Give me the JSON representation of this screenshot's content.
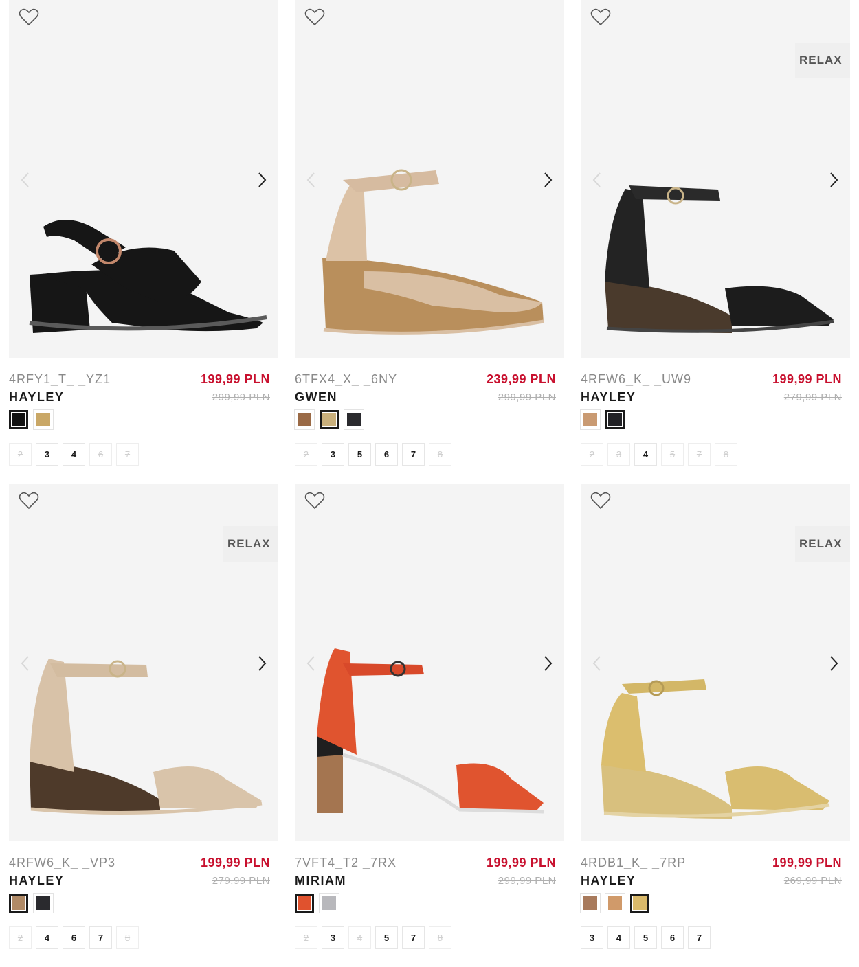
{
  "colors": {
    "price_red": "#c8102e",
    "old_price_grey": "#b0b0b0",
    "image_bg": "#f4f4f4"
  },
  "icons": {
    "wishlist": "heart-outline-icon",
    "prev": "chevron-left-icon",
    "next": "chevron-right-icon"
  },
  "products": [
    {
      "code": "4RFY1_T_ _YZ1",
      "name": "HAYLEY",
      "price": "199,99 PLN",
      "old_price": "299,99 PLN",
      "badge": "",
      "colors": [
        {
          "hex": "#111111",
          "selected": true
        },
        {
          "hex": "#c9a766",
          "selected": false
        }
      ],
      "sizes": [
        {
          "label": "2",
          "available": false
        },
        {
          "label": "3",
          "available": true
        },
        {
          "label": "4",
          "available": true
        },
        {
          "label": "6",
          "available": false
        },
        {
          "label": "7",
          "available": false
        }
      ]
    },
    {
      "code": "6TFX4_X_ _6NY",
      "name": "GWEN",
      "price": "239,99 PLN",
      "old_price": "299,99 PLN",
      "badge": "",
      "colors": [
        {
          "hex": "#9a6a46",
          "selected": false
        },
        {
          "hex": "#c9b07c",
          "selected": true
        },
        {
          "hex": "#2a2a2e",
          "selected": false
        }
      ],
      "sizes": [
        {
          "label": "2",
          "available": false
        },
        {
          "label": "3",
          "available": true
        },
        {
          "label": "5",
          "available": true
        },
        {
          "label": "6",
          "available": true
        },
        {
          "label": "7",
          "available": true
        },
        {
          "label": "8",
          "available": false
        }
      ]
    },
    {
      "code": "4RFW6_K_ _UW9",
      "name": "HAYLEY",
      "price": "199,99 PLN",
      "old_price": "279,99 PLN",
      "badge": "RELAX",
      "colors": [
        {
          "hex": "#c99a72",
          "selected": false
        },
        {
          "hex": "#222226",
          "selected": true
        }
      ],
      "sizes": [
        {
          "label": "2",
          "available": false
        },
        {
          "label": "3",
          "available": false
        },
        {
          "label": "4",
          "available": true
        },
        {
          "label": "5",
          "available": false
        },
        {
          "label": "7",
          "available": false
        },
        {
          "label": "8",
          "available": false
        }
      ]
    },
    {
      "code": "4RFW6_K_ _VP3",
      "name": "HAYLEY",
      "price": "199,99 PLN",
      "old_price": "279,99 PLN",
      "badge": "RELAX",
      "colors": [
        {
          "hex": "#b08a66",
          "selected": true
        },
        {
          "hex": "#2a2a2e",
          "selected": false
        }
      ],
      "sizes": [
        {
          "label": "2",
          "available": false
        },
        {
          "label": "4",
          "available": true
        },
        {
          "label": "6",
          "available": true
        },
        {
          "label": "7",
          "available": true
        },
        {
          "label": "8",
          "available": false
        }
      ]
    },
    {
      "code": "7VFT4_T2 _7RX",
      "name": "MIRIAM",
      "price": "199,99 PLN",
      "old_price": "299,99 PLN",
      "badge": "",
      "colors": [
        {
          "hex": "#e0522e",
          "selected": true
        },
        {
          "hex": "#b8b8bc",
          "selected": false
        }
      ],
      "sizes": [
        {
          "label": "2",
          "available": false
        },
        {
          "label": "3",
          "available": true
        },
        {
          "label": "4",
          "available": false
        },
        {
          "label": "5",
          "available": true
        },
        {
          "label": "7",
          "available": true
        },
        {
          "label": "8",
          "available": false
        }
      ]
    },
    {
      "code": "4RDB1_K_ _7RP",
      "name": "HAYLEY",
      "price": "199,99 PLN",
      "old_price": "269,99 PLN",
      "badge": "RELAX",
      "colors": [
        {
          "hex": "#a87a5c",
          "selected": false
        },
        {
          "hex": "#d09a6a",
          "selected": false
        },
        {
          "hex": "#d9b96a",
          "selected": true
        }
      ],
      "sizes": [
        {
          "label": "3",
          "available": true
        },
        {
          "label": "4",
          "available": true
        },
        {
          "label": "5",
          "available": true
        },
        {
          "label": "6",
          "available": true
        },
        {
          "label": "7",
          "available": true
        }
      ]
    }
  ]
}
